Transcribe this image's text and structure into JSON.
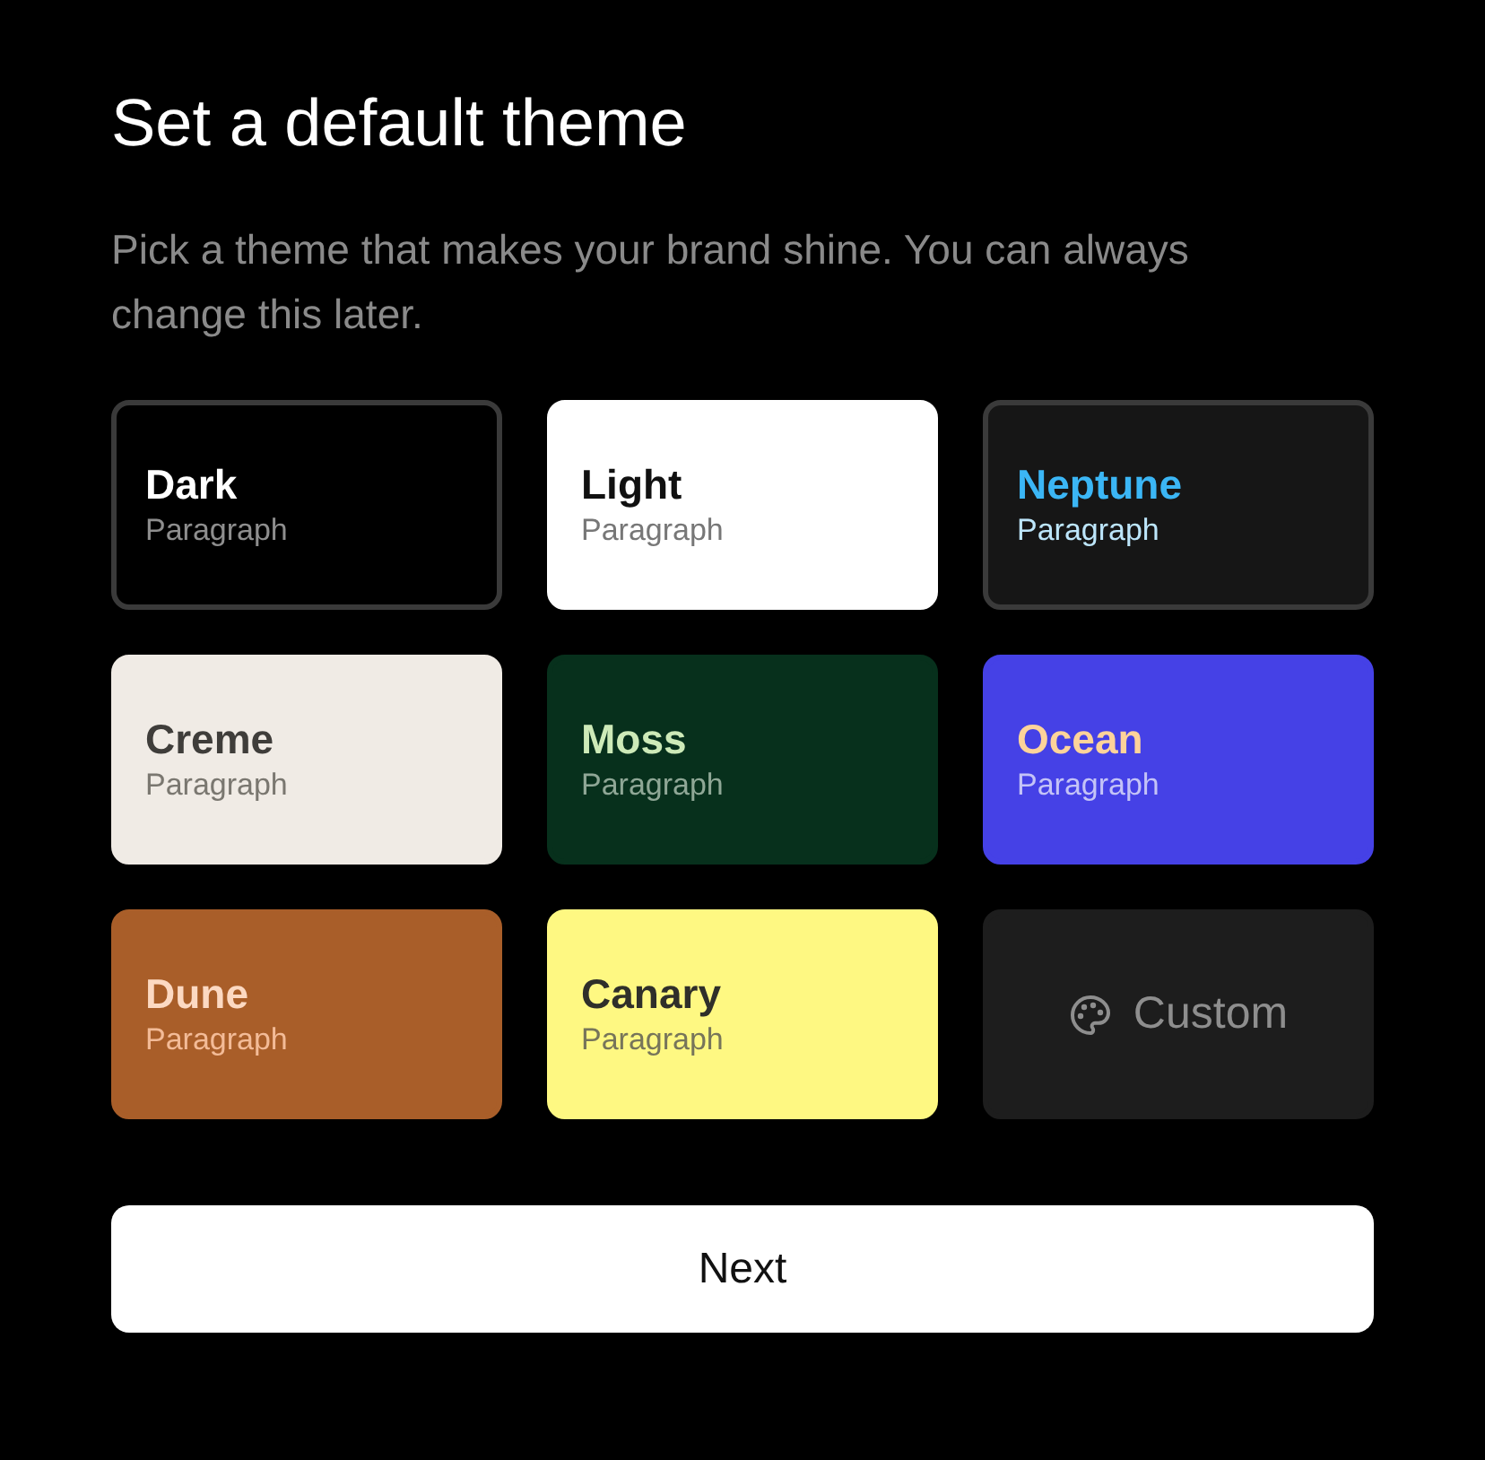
{
  "title": "Set a default theme",
  "subtitle": "Pick a theme that makes your brand shine. You can always change this later.",
  "themes": [
    {
      "kind": "theme",
      "color": "#000000",
      "name": {
        "text": "Dark",
        "color": "#ffffff"
      },
      "sample": {
        "text": "Paragraph",
        "color": "#8e8e8e"
      },
      "border": {
        "color": "#3a3a3a"
      }
    },
    {
      "kind": "theme",
      "color": "#ffffff",
      "name": {
        "text": "Light",
        "color": "#111111"
      },
      "sample": {
        "text": "Paragraph",
        "color": "#777777"
      }
    },
    {
      "kind": "theme",
      "color": "#161616",
      "name": {
        "text": "Neptune",
        "color": "#3bb6f5"
      },
      "sample": {
        "text": "Paragraph",
        "color": "#bde6fb"
      },
      "border": {
        "color": "#3a3a3a"
      }
    },
    {
      "kind": "theme",
      "color": "#f0ebe5",
      "name": {
        "text": "Creme",
        "color": "#3f3d3a"
      },
      "sample": {
        "text": "Paragraph",
        "color": "#7a7770"
      }
    },
    {
      "kind": "theme",
      "color": "#07301c",
      "name": {
        "text": "Moss",
        "color": "#cdeab8"
      },
      "sample": {
        "text": "Paragraph",
        "color": "#8fa796"
      }
    },
    {
      "kind": "theme",
      "color": "#4541e6",
      "name": {
        "text": "Ocean",
        "color": "#fdd39a"
      },
      "sample": {
        "text": "Paragraph",
        "color": "#c4c3f7"
      }
    },
    {
      "kind": "theme",
      "color": "#a95e29",
      "name": {
        "text": "Dune",
        "color": "#fcd9c2"
      },
      "sample": {
        "text": "Paragraph",
        "color": "#f3bb97"
      }
    },
    {
      "kind": "theme",
      "color": "#fef882",
      "name": {
        "text": "Canary",
        "color": "#2f2f2a"
      },
      "sample": {
        "text": "Paragraph",
        "color": "#77755a"
      }
    },
    {
      "kind": "custom",
      "color": "#1d1d1d",
      "name": {
        "text": "Custom",
        "color": "#8e8e8e"
      }
    }
  ],
  "button": "Next"
}
